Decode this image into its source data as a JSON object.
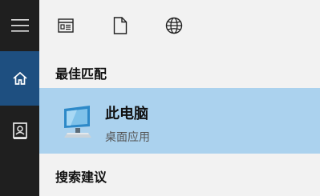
{
  "icons": {
    "menu": "hamburger-icon",
    "home": "home-icon",
    "user": "user-contact-icon",
    "filter_apps": "app-window-icon",
    "filter_documents": "document-icon",
    "filter_web": "globe-icon",
    "result": "computer-monitor-icon"
  },
  "colors": {
    "rail_bg": "#1f1f1f",
    "rail_active": "#1e4f80",
    "panel_bg": "#f2f2f2",
    "selected_result": "#abd2ee"
  },
  "sections": {
    "best_match": "最佳匹配",
    "suggestions": "搜索建议"
  },
  "best_result": {
    "name": "此电脑",
    "type": "桌面应用"
  }
}
